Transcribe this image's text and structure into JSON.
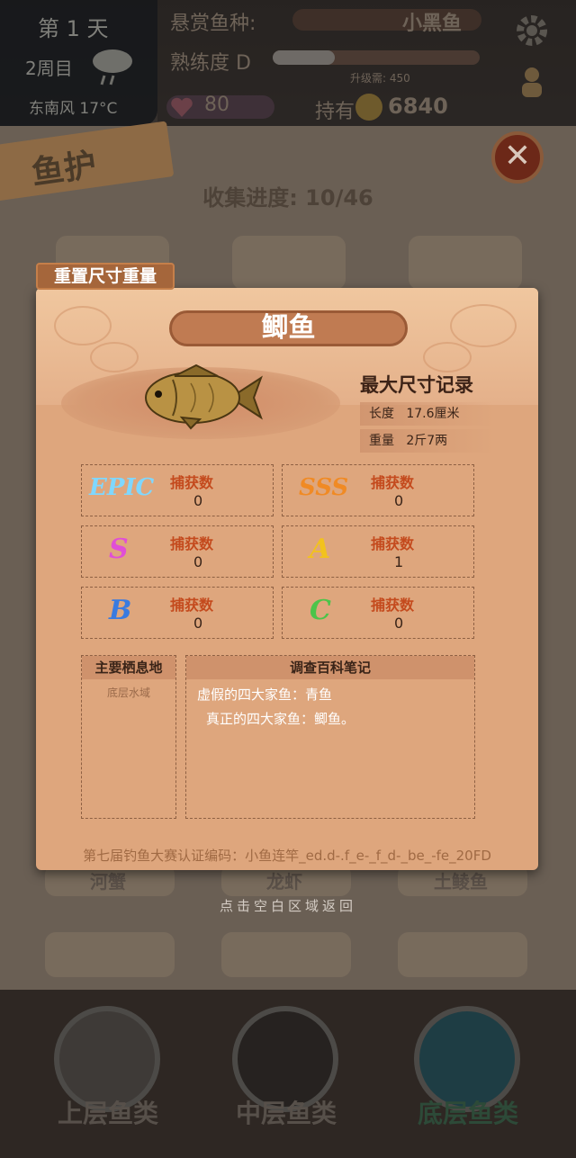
{
  "hud": {
    "day": "第 1 天",
    "week": "2周目",
    "wind": "东南风",
    "temperature": "17°C",
    "bounty_label": "悬赏鱼种:",
    "bounty_fish": "小黑鱼",
    "proficiency_label": "熟练度",
    "proficiency_grade": "D",
    "upgrade_label": "升级需: 450",
    "hp": "80",
    "holding_label": "持有",
    "coins": "6840"
  },
  "page": {
    "banner": "鱼护",
    "progress_label": "收集进度: 10/46",
    "close": "✕",
    "return_hint": "点击空白区域返回",
    "below_items": [
      "河蟹",
      "龙虾",
      "土鲮鱼"
    ]
  },
  "bottom_tabs": [
    {
      "label": "上层鱼类"
    },
    {
      "label": "中层鱼类"
    },
    {
      "label": "底层鱼类"
    }
  ],
  "dialog": {
    "reset_button": "重置尺寸重量",
    "fish_name": "鲫鱼",
    "record_title": "最大尺寸记录",
    "length_label": "长度",
    "length_value": "17.6厘米",
    "weight_label": "重量",
    "weight_value": "2斤7两",
    "grades": [
      {
        "icon": "EPIC",
        "label": "捕获数",
        "value": "0",
        "color": "#7fd7ff"
      },
      {
        "icon": "SSS",
        "label": "捕获数",
        "value": "0",
        "color": "#f08a24"
      },
      {
        "icon": "S",
        "label": "捕获数",
        "value": "0",
        "color": "#e04fd6"
      },
      {
        "icon": "A",
        "label": "捕获数",
        "value": "1",
        "color": "#f2c21d"
      },
      {
        "icon": "B",
        "label": "捕获数",
        "value": "0",
        "color": "#3a7be0"
      },
      {
        "icon": "C",
        "label": "捕获数",
        "value": "0",
        "color": "#4cc44a"
      }
    ],
    "habitat_title": "主要栖息地",
    "habitat_value": "底层水域",
    "notes_title": "调查百科笔记",
    "notes": [
      "虚假的四大家鱼：青鱼",
      "真正的四大家鱼：鲫鱼。"
    ],
    "code": "第七届钓鱼大赛认证编码：小鱼连竿_ed.d-.f_e-_f_d-_be_-fe_20FD"
  }
}
